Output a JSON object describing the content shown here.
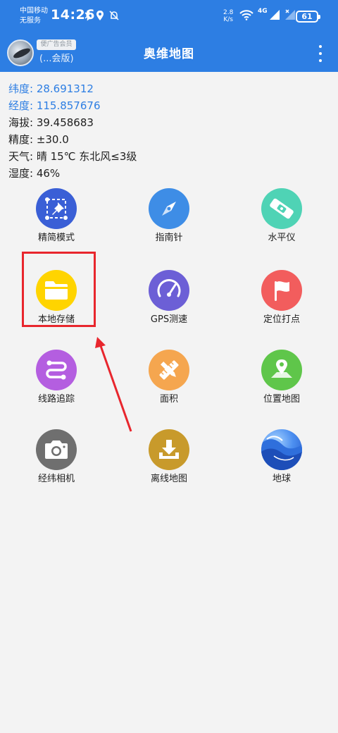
{
  "status": {
    "carrier_1": "中国移动",
    "carrier_2": "无服务",
    "time": "14:26",
    "speed_value": "2.8",
    "speed_unit": "K/s",
    "network": "4G",
    "battery": "61"
  },
  "appbar": {
    "badge": "便广告会员",
    "member_text": "(...会版)",
    "title": "奥维地图"
  },
  "info": {
    "latitude": "纬度: 28.691312",
    "longitude": "经度: 115.857676",
    "altitude": "海拔: 39.458683",
    "accuracy": "精度: ±30.0",
    "weather": "天气: 晴  15℃  东北风≤3级",
    "humidity": "湿度: 46%"
  },
  "grid": [
    {
      "label": "精简模式",
      "icon": "pin-ruler-icon",
      "color": "#3a5fd6"
    },
    {
      "label": "指南针",
      "icon": "compass-icon",
      "color": "#3e8de6"
    },
    {
      "label": "水平仪",
      "icon": "level-icon",
      "color": "#4fd3b5"
    },
    {
      "label": "本地存储",
      "icon": "folder-icon",
      "color": "#ffd400"
    },
    {
      "label": "GPS测速",
      "icon": "speedometer-icon",
      "color": "#6c5fd6"
    },
    {
      "label": "定位打点",
      "icon": "flag-icon",
      "color": "#f25d5d"
    },
    {
      "label": "线路追踪",
      "icon": "route-icon",
      "color": "#b45ee0"
    },
    {
      "label": "面积",
      "icon": "ruler-pencil-icon",
      "color": "#f5a64f"
    },
    {
      "label": "位置地图",
      "icon": "map-pin-icon",
      "color": "#5fc64a"
    },
    {
      "label": "经纬相机",
      "icon": "camera-icon",
      "color": "#6f6f6f"
    },
    {
      "label": "离线地图",
      "icon": "download-icon",
      "color": "#c89a2b"
    },
    {
      "label": "地球",
      "icon": "globe-wave-icon",
      "color": "#2f6fdc"
    }
  ],
  "colors": {
    "primary": "#2d7ee3",
    "annotation": "#e8262d"
  }
}
